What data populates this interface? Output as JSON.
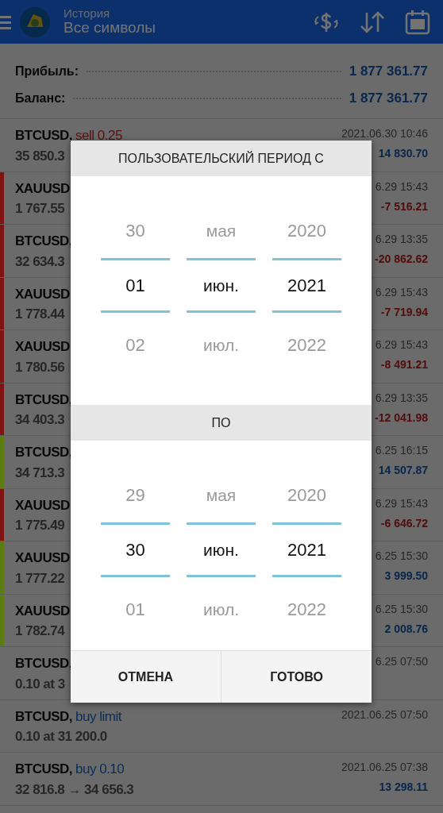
{
  "header": {
    "title": "История",
    "subtitle": "Все символы"
  },
  "summary": [
    {
      "label": "Прибыль:",
      "value": "1 877 361.77"
    },
    {
      "label": "Баланс:",
      "value": "1 877 361.77"
    }
  ],
  "deals": [
    {
      "symbol": "BTCUSD,",
      "action": "sell 0.25",
      "sell": true,
      "prices": "35 850.3",
      "time": "2021.06.30 10:46",
      "profit": "14 830.70",
      "loss": false
    },
    {
      "symbol": "XAUUSD",
      "prices": "1 767.55",
      "time": "6.29 15:43",
      "profit": "-7 516.21",
      "loss": true,
      "color": "#7f1212"
    },
    {
      "symbol": "BTCUSD,",
      "prices": "32 634.3",
      "time": "6.29 13:35",
      "profit": "-20 862.62",
      "loss": true,
      "color": "#7f1212"
    },
    {
      "symbol": "XAUUSD",
      "prices": "1 778.44",
      "time": "6.29 15:43",
      "profit": "-7 719.94",
      "loss": true,
      "color": "#7f1212"
    },
    {
      "symbol": "XAUUSD",
      "prices": "1 780.56",
      "time": "6.29 15:43",
      "profit": "-8 491.21",
      "loss": true,
      "color": "#7f1212"
    },
    {
      "symbol": "BTCUSD,",
      "prices": "34 403.3",
      "time": "6.29 13:35",
      "profit": "-12 041.98",
      "loss": true,
      "color": "#7f1212"
    },
    {
      "symbol": "BTCUSD,",
      "prices": "34 713.3",
      "time": "6.25 16:15",
      "profit": "14 507.87",
      "loss": false,
      "color": "#5b7b13"
    },
    {
      "symbol": "XAUUSD",
      "prices": "1 775.49",
      "time": "6.29 15:43",
      "profit": "-6 646.72",
      "loss": true,
      "color": "#7f1212"
    },
    {
      "symbol": "XAUUSD",
      "prices": "1 777.22",
      "time": "6.25 15:30",
      "profit": "3 999.50",
      "loss": false,
      "color": "#5b7b13"
    },
    {
      "symbol": "XAUUSD",
      "prices": "1 782.74",
      "time": "6.25 15:30",
      "profit": "2 008.76",
      "loss": false,
      "color": "#5b7b13"
    },
    {
      "symbol": "BTCUSD,",
      "prices": "0.10 at 3",
      "time": "6.25 07:50"
    },
    {
      "symbol": "BTCUSD,",
      "action": "buy limit",
      "sell": false,
      "prices": "0.10 at 31 200.0",
      "time": "2021.06.25 07:50"
    },
    {
      "symbol": "BTCUSD,",
      "action": "buy 0.10",
      "sell": false,
      "prices": "32 816.8 → 34 656.3",
      "time": "2021.06.25 07:38",
      "profit": "13 298.11",
      "loss": false
    }
  ],
  "dialog": {
    "sections": [
      {
        "title": "ПОЛЬЗОВАТЕЛЬСКИЙ ПЕРИОД С",
        "columns": [
          {
            "items": [
              {
                "text": "30",
                "selected": false
              },
              {
                "text": "01",
                "selected": true
              },
              {
                "text": "02",
                "selected": false
              }
            ]
          },
          {
            "items": [
              {
                "text": "мая",
                "selected": false
              },
              {
                "text": "июн.",
                "selected": true
              },
              {
                "text": "июл.",
                "selected": false
              }
            ]
          },
          {
            "items": [
              {
                "text": "2020",
                "selected": false
              },
              {
                "text": "2021",
                "selected": true
              },
              {
                "text": "2022",
                "selected": false
              }
            ]
          }
        ]
      },
      {
        "title": "ПО",
        "columns": [
          {
            "items": [
              {
                "text": "29",
                "selected": false
              },
              {
                "text": "30",
                "selected": true
              },
              {
                "text": "01",
                "selected": false
              }
            ]
          },
          {
            "items": [
              {
                "text": "мая",
                "selected": false
              },
              {
                "text": "июн.",
                "selected": true
              },
              {
                "text": "июл.",
                "selected": false
              }
            ]
          },
          {
            "items": [
              {
                "text": "2020",
                "selected": false
              },
              {
                "text": "2021",
                "selected": true
              },
              {
                "text": "2022",
                "selected": false
              }
            ]
          }
        ]
      }
    ],
    "buttons": [
      "ОТМЕНА",
      "ГОТОВО"
    ]
  }
}
